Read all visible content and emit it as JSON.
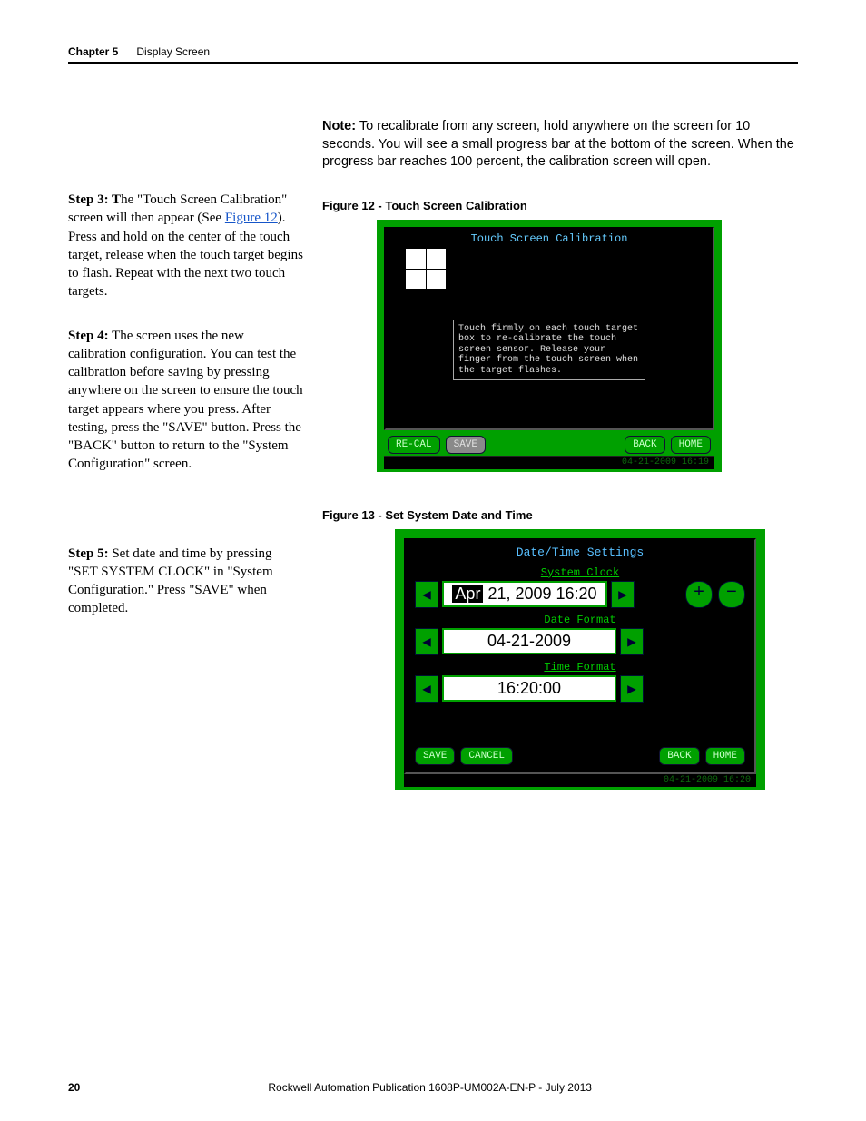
{
  "header": {
    "chapter": "Chapter 5",
    "section": "Display Screen"
  },
  "note": {
    "label": "Note:",
    "text": "To recalibrate from any screen, hold anywhere on the screen for 10 seconds. You will see a small progress bar at the bottom of the screen. When the progress bar reaches 100 percent, the calibration screen will open."
  },
  "steps": {
    "s3_label": "Step 3: T",
    "s3_text": "he \"Touch Screen Calibration\" screen will then appear (See ",
    "s3_link": "Figure 12",
    "s3_cont": "). Press and hold on the center of the touch target, release when the touch target begins to flash. Repeat with the next two touch targets.",
    "s4_label": "Step 4:",
    "s4_text": " The screen uses the new calibration configuration. You can test the calibration before saving by pressing anywhere on the screen to ensure the touch target appears where you press. After testing, press the \"SAVE\" button. Press the \"BACK\" button to return to the \"System Configuration\" screen.",
    "s5_label": "Step 5:",
    "s5_text": "  Set date and time by pressing \"SET SYSTEM CLOCK\" in \"System Configuration.\" Press \"SAVE\" when completed."
  },
  "fig12": {
    "caption": "Figure 12 - Touch Screen Calibration",
    "title": "Touch Screen Calibration",
    "msg": "Touch firmly on each touch target box to re-calibrate the touch screen sensor. Release your finger from the touch screen when the target flashes.",
    "btn_recal": "RE-CAL",
    "btn_save": "SAVE",
    "btn_back": "BACK",
    "btn_home": "HOME",
    "status": "04-21-2009 16:19"
  },
  "fig13": {
    "caption": "Figure 13 - Set System Date and Time",
    "title": "Date/Time Settings",
    "sysclock_label": "System Clock",
    "clock_hl": "Apr",
    "clock_rest": " 21, 2009 16:20",
    "dateformat_label": "Date Format",
    "dateformat_val": "04-21-2009",
    "timeformat_label": "Time Format",
    "timeformat_val": "16:20:00",
    "btn_save": "SAVE",
    "btn_cancel": "CANCEL",
    "btn_back": "BACK",
    "btn_home": "HOME",
    "plus": "+",
    "minus": "−",
    "status": "04-21-2009 16:20"
  },
  "footer": {
    "page": "20",
    "pub": "Rockwell Automation Publication 1608P-UM002A-EN-P - July 2013"
  }
}
